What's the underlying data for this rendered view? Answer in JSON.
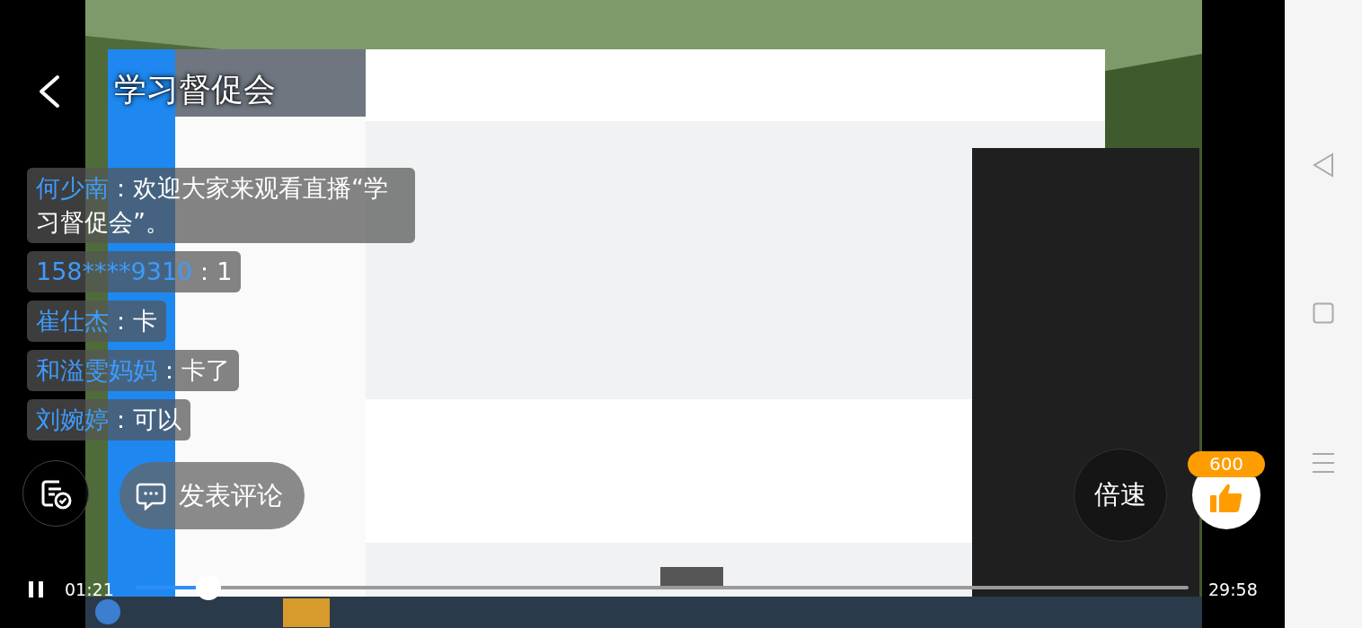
{
  "header": {
    "title": "学习督促会"
  },
  "comments": [
    {
      "name": "何少南",
      "separator": "：",
      "text": "欢迎大家来观看直播“学习督促会”。"
    },
    {
      "name": "158****9310",
      "separator": "：",
      "text": "1"
    },
    {
      "name": "崔仕杰",
      "separator": "：",
      "text": "卡"
    },
    {
      "name": "和溢雯妈妈",
      "separator": "：",
      "text": "卡了"
    },
    {
      "name": "刘婉婷",
      "separator": "：",
      "text": "可以"
    }
  ],
  "comment_button": {
    "label": "发表评论"
  },
  "speed_button": {
    "label": "倍速"
  },
  "like": {
    "count": "600"
  },
  "player": {
    "elapsed": "01:21",
    "duration": "29:58",
    "level": 0.056,
    "playing": true
  }
}
